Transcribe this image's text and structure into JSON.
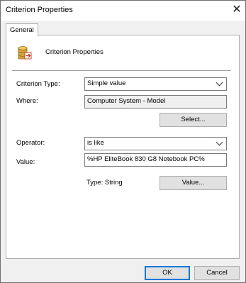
{
  "window": {
    "title": "Criterion Properties"
  },
  "tabs": [
    {
      "label": "General"
    }
  ],
  "header": {
    "title": "Criterion Properties"
  },
  "form": {
    "criterion_type_label": "Criterion Type:",
    "criterion_type_value": "Simple value",
    "where_label": "Where:",
    "where_value": "Computer System - Model",
    "select_button": "Select...",
    "operator_label": "Operator:",
    "operator_value": "is like",
    "value_label": "Value:",
    "value_value": "%HP EliteBook 830 G8 Notebook PC%",
    "type_text": "Type: String",
    "value_button": "Value..."
  },
  "footer": {
    "ok": "OK",
    "cancel": "Cancel"
  }
}
